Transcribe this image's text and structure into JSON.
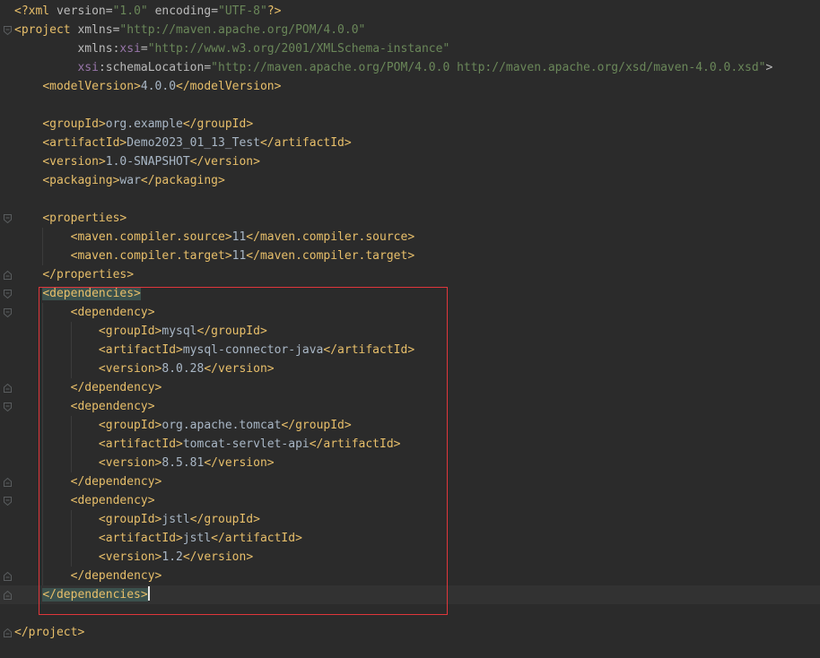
{
  "editor": {
    "colors": {
      "background": "#2b2b2b",
      "tag": "#e8bf6a",
      "text": "#a9b7c6",
      "attribute": "#bababa",
      "namespace": "#9876aa",
      "string": "#6a8759",
      "highlight_box": "#e0363b"
    },
    "lines": [
      {
        "t": "<?xml version=\"1.0\" encoding=\"UTF-8\"?>",
        "indent": 0
      },
      {
        "t": "<project xmlns=\"http://maven.apache.org/POM/4.0.0\"",
        "indent": 0
      },
      {
        "t": "xmlns:xsi=\"http://www.w3.org/2001/XMLSchema-instance\"",
        "indent": 9
      },
      {
        "t": "xsi:schemaLocation=\"http://maven.apache.org/POM/4.0.0 http://maven.apache.org/xsd/maven-4.0.0.xsd\">",
        "indent": 9
      },
      {
        "t": "<modelVersion>4.0.0</modelVersion>",
        "indent": 4
      },
      {
        "t": "",
        "indent": 0
      },
      {
        "t": "<groupId>org.example</groupId>",
        "indent": 4
      },
      {
        "t": "<artifactId>Demo2023_01_13_Test</artifactId>",
        "indent": 4
      },
      {
        "t": "<version>1.0-SNAPSHOT</version>",
        "indent": 4
      },
      {
        "t": "<packaging>war</packaging>",
        "indent": 4
      },
      {
        "t": "",
        "indent": 0
      },
      {
        "t": "<properties>",
        "indent": 4
      },
      {
        "t": "<maven.compiler.source>11</maven.compiler.source>",
        "indent": 8
      },
      {
        "t": "<maven.compiler.target>11</maven.compiler.target>",
        "indent": 8
      },
      {
        "t": "</properties>",
        "indent": 4
      },
      {
        "t": "<dependencies>",
        "indent": 4
      },
      {
        "t": "<dependency>",
        "indent": 8
      },
      {
        "t": "<groupId>mysql</groupId>",
        "indent": 12
      },
      {
        "t": "<artifactId>mysql-connector-java</artifactId>",
        "indent": 12
      },
      {
        "t": "<version>8.0.28</version>",
        "indent": 12
      },
      {
        "t": "</dependency>",
        "indent": 8
      },
      {
        "t": "<dependency>",
        "indent": 8
      },
      {
        "t": "<groupId>org.apache.tomcat</groupId>",
        "indent": 12
      },
      {
        "t": "<artifactId>tomcat-servlet-api</artifactId>",
        "indent": 12
      },
      {
        "t": "<version>8.5.81</version>",
        "indent": 12
      },
      {
        "t": "</dependency>",
        "indent": 8
      },
      {
        "t": "<dependency>",
        "indent": 8
      },
      {
        "t": "<groupId>jstl</groupId>",
        "indent": 12
      },
      {
        "t": "<artifactId>jstl</artifactId>",
        "indent": 12
      },
      {
        "t": "<version>1.2</version>",
        "indent": 12
      },
      {
        "t": "</dependency>",
        "indent": 8
      },
      {
        "t": "</dependencies>",
        "indent": 4
      },
      {
        "t": "",
        "indent": 0
      },
      {
        "t": "</project>",
        "indent": 0
      }
    ]
  }
}
